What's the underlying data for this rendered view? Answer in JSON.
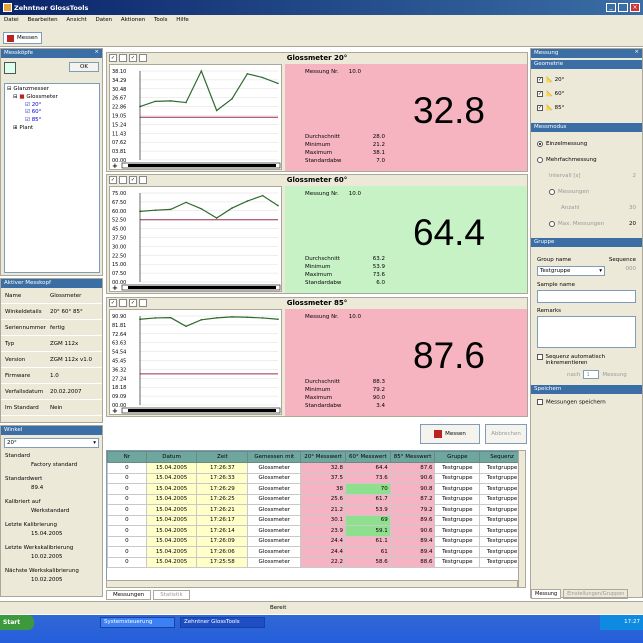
{
  "window": {
    "title": "Zehntner GlossTools"
  },
  "menu": [
    "Datei",
    "Bearbeiten",
    "Ansicht",
    "Daten",
    "Aktionen",
    "Tools",
    "Hilfe"
  ],
  "toolbar": {
    "messen": "Messen"
  },
  "left": {
    "messkopfe_title": "Messköpfe",
    "ok_label": "OK",
    "tree": {
      "root": "Glanzmesser",
      "child": "Glossmeter",
      "a20": "20°",
      "a60": "60°",
      "a85": "85°",
      "plant": "Plant"
    },
    "aktiver_title": "Aktiver Messkopf",
    "props": [
      {
        "k": "Name",
        "v": "Glossmeter"
      },
      {
        "k": "Winkeldetails",
        "v": "20° 60° 85°"
      },
      {
        "k": "Seriennummer",
        "v": "fertig"
      },
      {
        "k": "Typ",
        "v": "ZGM 112x"
      },
      {
        "k": "Version",
        "v": "ZGM 112x v1.0"
      },
      {
        "k": "Firmware",
        "v": "1.0"
      },
      {
        "k": "Verfallsdatum",
        "v": "20.02.2007"
      },
      {
        "k": "Im Standard",
        "v": "Nein"
      }
    ],
    "winkel_title": "Winkel",
    "winkel_value": "20°",
    "winkel_rows": [
      {
        "k": "Standard",
        "v": "Factory standard"
      },
      {
        "k": "Standardwert",
        "v": "89.4"
      },
      {
        "k": "Kalibriert auf",
        "v": "Werkstandard"
      },
      {
        "k": "Letzte Kalibrierung",
        "v": "15.04.2005"
      },
      {
        "k": "Letzte Werkskalibrierung",
        "v": "10.02.2005"
      },
      {
        "k": "Nächste Werkskalibrierung",
        "v": "10.02.2005"
      }
    ]
  },
  "gauges": [
    {
      "title": "Glossmeter 20°",
      "messung_label": "Messung Nr.",
      "messung": "10.0",
      "big": "32.8",
      "color": "#f6b4c0",
      "stats": [
        [
          "Durchschnitt",
          "28.0"
        ],
        [
          "Minimum",
          "21.2"
        ],
        [
          "Maximum",
          "38.1"
        ],
        [
          "Standardabw",
          "7.0"
        ]
      ],
      "yticks": [
        "38.10",
        "34.29",
        "30.48",
        "26.67",
        "22.86",
        "19.05",
        "15.24",
        "11.43",
        "07.62",
        "03.81",
        "00.00"
      ],
      "ymax": 38.1,
      "series": [
        22.9,
        25.1,
        25.3,
        24.6,
        38.1,
        21.2,
        26.2,
        36.9,
        35.3,
        32.8
      ],
      "refline": 18.3
    },
    {
      "title": "Glossmeter 60°",
      "messung_label": "Messung Nr.",
      "messung": "10.0",
      "big": "64.4",
      "color": "#c6f2c6",
      "stats": [
        [
          "Durchschnitt",
          "63.2"
        ],
        [
          "Minimum",
          "53.9"
        ],
        [
          "Maximum",
          "73.6"
        ],
        [
          "Standardabw",
          "6.0"
        ]
      ],
      "yticks": [
        "75.00",
        "67.50",
        "60.00",
        "52.50",
        "45.00",
        "37.50",
        "30.00",
        "22.50",
        "15.00",
        "07.50",
        "00.00"
      ],
      "ymax": 75,
      "series": [
        59.5,
        60.5,
        61.2,
        67.1,
        61.7,
        53.9,
        62.3,
        68.2,
        72.8,
        64.4
      ],
      "refline": 52.5
    },
    {
      "title": "Glossmeter 85°",
      "messung_label": "Messung Nr.",
      "messung": "10.0",
      "big": "87.6",
      "color": "#f6b4c0",
      "stats": [
        [
          "Durchschnitt",
          "88.3"
        ],
        [
          "Minimum",
          "79.2"
        ],
        [
          "Maximum",
          "90.0"
        ],
        [
          "Standardabw",
          "3.4"
        ]
      ],
      "yticks": [
        "90.90",
        "81.81",
        "72.64",
        "63.63",
        "54.54",
        "45.45",
        "36.32",
        "27.24",
        "18.18",
        "09.09",
        "00.00"
      ],
      "ymax": 90.9,
      "series": [
        87.6,
        88.9,
        89.2,
        80.4,
        87.0,
        89.0,
        90.0,
        89.6,
        88.9,
        87.6
      ],
      "refline": 31.8
    }
  ],
  "buttons": {
    "messen": "Messen",
    "abbrechen": "Abbrechen"
  },
  "table": {
    "headers": [
      "Nr",
      "Datum",
      "Zeit",
      "Gemessen mit",
      "20° Messwert",
      "60° Messwert",
      "85° Messwert",
      "Gruppe",
      "Sequenz"
    ],
    "rows": [
      [
        "0",
        "15.04.2005",
        "17:26:37",
        "Glossmeter",
        "32.8",
        "64.4",
        "87.6",
        "Testgruppe",
        "Testgruppe"
      ],
      [
        "0",
        "15.04.2005",
        "17:26:33",
        "Glossmeter",
        "37.5",
        "73.6",
        "90.6",
        "Testgruppe",
        "Testgruppe"
      ],
      [
        "0",
        "15.04.2005",
        "17:26:29",
        "Glossmeter",
        "38",
        "70",
        "90.8",
        "Testgruppe",
        "Testgruppe"
      ],
      [
        "0",
        "15.04.2005",
        "17:26:25",
        "Glossmeter",
        "25.6",
        "61.7",
        "87.2",
        "Testgruppe",
        "Testgruppe"
      ],
      [
        "0",
        "15.04.2005",
        "17:26:21",
        "Glossmeter",
        "21.2",
        "53.9",
        "79.2",
        "Testgruppe",
        "Testgruppe"
      ],
      [
        "0",
        "15.04.2005",
        "17:26:17",
        "Glossmeter",
        "30.1",
        "69",
        "89.6",
        "Testgruppe",
        "Testgruppe"
      ],
      [
        "0",
        "15.04.2005",
        "17:26:14",
        "Glossmeter",
        "23.9",
        "59.1",
        "90.6",
        "Testgruppe",
        "Testgruppe"
      ],
      [
        "0",
        "15.04.2005",
        "17:26:09",
        "Glossmeter",
        "24.4",
        "61.1",
        "89.4",
        "Testgruppe",
        "Testgruppe"
      ],
      [
        "0",
        "15.04.2005",
        "17:26:06",
        "Glossmeter",
        "24.4",
        "61",
        "89.4",
        "Testgruppe",
        "Testgruppe"
      ],
      [
        "0",
        "15.04.2005",
        "17:25:58",
        "Glossmeter",
        "22.2",
        "58.6",
        "88.6",
        "Testgruppe",
        "Testgruppe"
      ]
    ],
    "tabs": [
      "Messungen",
      "Statistik"
    ]
  },
  "right": {
    "messung_title": "Messung",
    "geometrie_title": "Geometrie",
    "geo": [
      "20°",
      "60°",
      "85°"
    ],
    "messmodus_title": "Messmodus",
    "einzel": "Einzelmessung",
    "mehrfach": "Mehrfachmessung",
    "intervall": "Intervall [s]",
    "intervall_val": "2",
    "messungen": "Messungen",
    "anzahl": "Anzahl",
    "anzahl_val": "30",
    "max": "Max. Messungen",
    "max_val": "20",
    "gruppe_title": "Gruppe",
    "group_name": "Group name",
    "sequence": "Sequence",
    "group_value": "Testgruppe",
    "seq_value": "000",
    "sample_name": "Sample name",
    "remarks": "Remarks",
    "seq_auto": "Sequenz automatisch inkrementieren",
    "nach": "nach",
    "nach_val": "1",
    "messung_lbl": "Messung",
    "speichern_title": "Speichern",
    "speichern_cb": "Messungen speichern",
    "tabs": [
      "Messung",
      "Einstellungen/Gruppen"
    ]
  },
  "status": {
    "text": "Bereit"
  },
  "taskbar": {
    "start": "Start",
    "items": [
      "Systemsteuerung",
      "Zehntner GlossTools"
    ],
    "time": "17:27"
  }
}
